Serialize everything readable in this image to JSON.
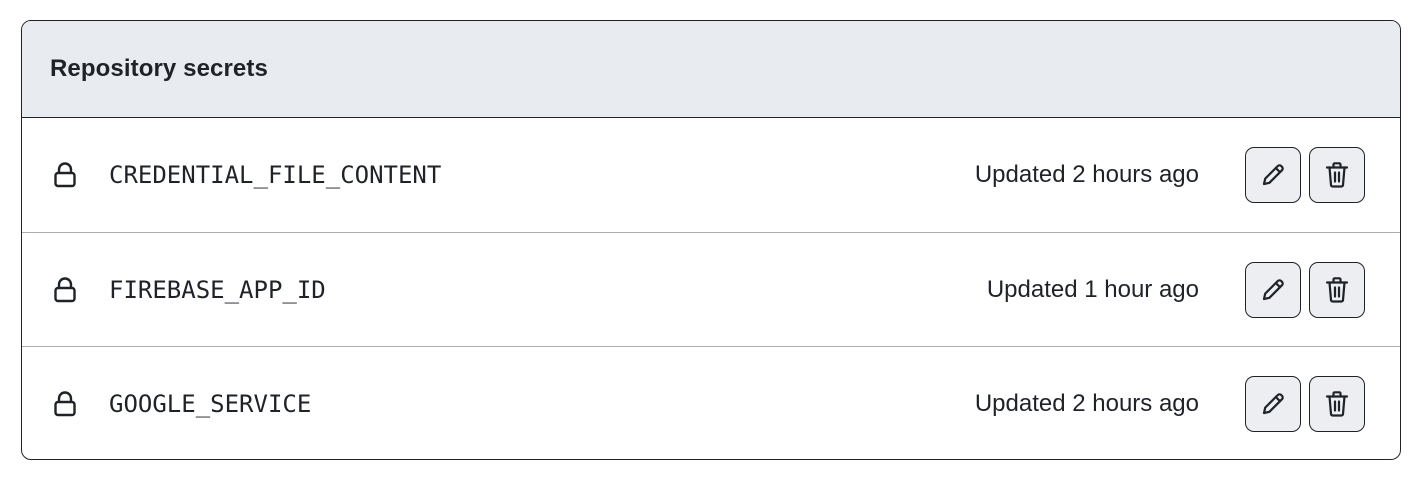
{
  "panel": {
    "title": "Repository secrets"
  },
  "secrets": [
    {
      "name": "CREDENTIAL_FILE_CONTENT",
      "updated": "Updated 2 hours ago",
      "icon": "lock-icon",
      "actions": [
        "pencil-icon",
        "trash-icon"
      ]
    },
    {
      "name": "FIREBASE_APP_ID",
      "updated": "Updated 1 hour ago",
      "icon": "lock-icon",
      "actions": [
        "pencil-icon",
        "trash-icon"
      ]
    },
    {
      "name": "GOOGLE_SERVICE",
      "updated": "Updated 2 hours ago",
      "icon": "lock-icon",
      "actions": [
        "pencil-icon",
        "trash-icon"
      ]
    }
  ],
  "colors": {
    "header_bg": "#e8ebef",
    "border": "#1f2328",
    "row_divider": "#a9adb3",
    "button_bg": "#eceef1",
    "text": "#1f2328"
  }
}
